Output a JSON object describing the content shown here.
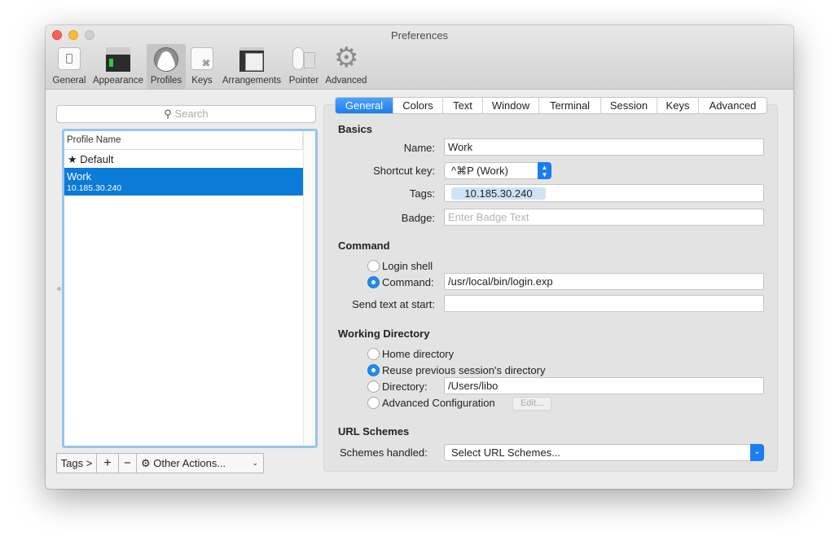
{
  "window": {
    "title": "Preferences"
  },
  "toolbar": {
    "items": [
      {
        "label": "General",
        "icon": "general-switch-icon"
      },
      {
        "label": "Appearance",
        "icon": "appearance-window-icon"
      },
      {
        "label": "Profiles",
        "icon": "profiles-person-icon",
        "selected": true
      },
      {
        "label": "Keys",
        "icon": "keys-command-icon"
      },
      {
        "label": "Arrangements",
        "icon": "arrangements-windows-icon"
      },
      {
        "label": "Pointer",
        "icon": "pointer-mouse-icon"
      },
      {
        "label": "Advanced",
        "icon": "advanced-gear-icon"
      }
    ]
  },
  "sidebar": {
    "search_placeholder": "Search",
    "column_header": "Profile Name",
    "profiles": [
      {
        "name": "Default",
        "prefix": "★",
        "subtitle": ""
      },
      {
        "name": "Work",
        "subtitle": "10.185.30.240",
        "selected": true
      }
    ],
    "tags_button": "Tags >",
    "add_button": "+",
    "remove_button": "−",
    "other_actions": "Other Actions..."
  },
  "tabs": [
    "General",
    "Colors",
    "Text",
    "Window",
    "Terminal",
    "Session",
    "Keys",
    "Advanced"
  ],
  "active_tab": "General",
  "basics": {
    "heading": "Basics",
    "name_label": "Name:",
    "name_value": "Work",
    "shortcut_label": "Shortcut key:",
    "shortcut_value": "^⌘P (Work)",
    "tags_label": "Tags:",
    "tag": "10.185.30.240",
    "badge_label": "Badge:",
    "badge_placeholder": "Enter Badge Text"
  },
  "command": {
    "heading": "Command",
    "login_shell": "Login shell",
    "command_label": "Command:",
    "command_value": "/usr/local/bin/login.exp",
    "selected": "Command",
    "send_text_label": "Send text at start:",
    "send_text_value": ""
  },
  "working_directory": {
    "heading": "Working Directory",
    "home": "Home directory",
    "reuse": "Reuse previous session's directory",
    "directory_label": "Directory:",
    "directory_value": "/Users/libo",
    "advanced": "Advanced Configuration",
    "edit_button": "Edit...",
    "selected": "Reuse previous session's directory"
  },
  "url_schemes": {
    "heading": "URL Schemes",
    "label": "Schemes handled:",
    "value": "Select URL Schemes..."
  },
  "colors": {
    "accent": "#1a7ef0",
    "selection": "#0a7bd6",
    "tag_bg": "#cfe3f7"
  }
}
